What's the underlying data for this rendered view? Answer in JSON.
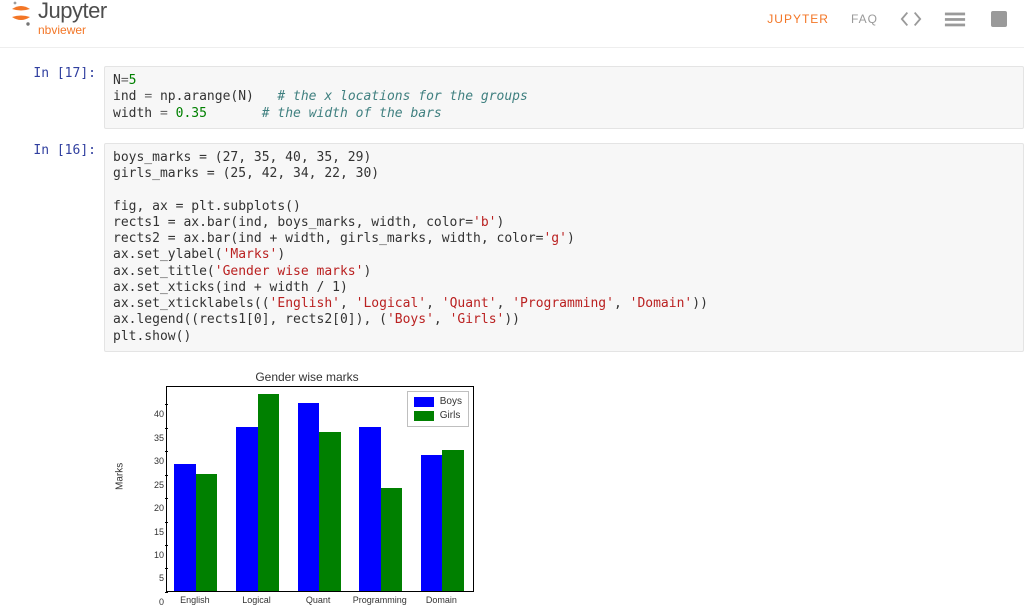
{
  "header": {
    "brand_name": "Jupyter",
    "brand_sub": "nbviewer",
    "nav_jupyter": "JUPYTER",
    "nav_faq": "FAQ"
  },
  "cells": {
    "c0": {
      "prompt": "In [17]:",
      "l0a": "N",
      "l0b": "=",
      "l0c": "5",
      "l1a": "ind ",
      "l1b": "=",
      "l1c": " np.arange(N)   ",
      "l1d": "# the x locations for the groups",
      "l2a": "width ",
      "l2b": "=",
      "l2c": " ",
      "l2d": "0.35",
      "l2e": "       ",
      "l2f": "# the width of the bars"
    },
    "c1": {
      "prompt": "In [16]:",
      "l0": "boys_marks = (27, 35, 40, 35, 29)",
      "l1": "girls_marks = (25, 42, 34, 22, 30)",
      "l2": "",
      "l3": "fig, ax = plt.subplots()",
      "l4a": "rects1 = ax.bar(ind, boys_marks, width, color=",
      "l4b": "'b'",
      "l4c": ")",
      "l5a": "rects2 = ax.bar(ind + width, girls_marks, width, color=",
      "l5b": "'g'",
      "l5c": ")",
      "l6a": "ax.set_ylabel(",
      "l6b": "'Marks'",
      "l6c": ")",
      "l7a": "ax.set_title(",
      "l7b": "'Gender wise marks'",
      "l7c": ")",
      "l8": "ax.set_xticks(ind + width / 1)",
      "l9a": "ax.set_xticklabels((",
      "l9b": "'English'",
      "l9c": ", ",
      "l9d": "'Logical'",
      "l9e": ", ",
      "l9f": "'Quant'",
      "l9g": ", ",
      "l9h": "'Programming'",
      "l9i": ", ",
      "l9j": "'Domain'",
      "l9k": "))",
      "l10a": "ax.legend((rects1[0], rects2[0]), (",
      "l10b": "'Boys'",
      "l10c": ", ",
      "l10d": "'Girls'",
      "l10e": "))",
      "l11": "plt.show()"
    }
  },
  "chart_data": {
    "type": "bar",
    "title": "Gender wise marks",
    "xlabel": "",
    "ylabel": "Marks",
    "categories": [
      "English",
      "Logical",
      "Quant",
      "Programming",
      "Domain"
    ],
    "series": [
      {
        "name": "Boys",
        "values": [
          27,
          35,
          40,
          35,
          29
        ],
        "color": "#0000ff"
      },
      {
        "name": "Girls",
        "values": [
          25,
          42,
          34,
          22,
          30
        ],
        "color": "#008000"
      }
    ],
    "yticks": [
      0,
      5,
      10,
      15,
      20,
      25,
      30,
      35,
      40
    ],
    "ylim": [
      0,
      44
    ]
  }
}
